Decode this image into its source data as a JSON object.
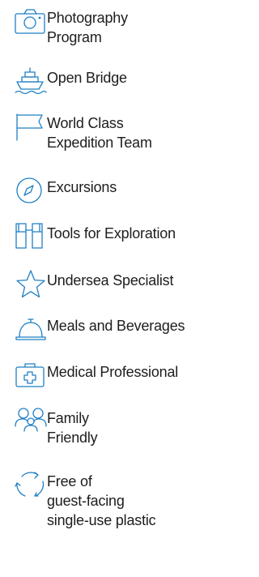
{
  "features": [
    {
      "label": "Photography\nProgram",
      "icon": "camera-icon"
    },
    {
      "label": "Open Bridge",
      "icon": "ship-icon"
    },
    {
      "label": "World Class\nExpedition Team",
      "icon": "flag-icon"
    },
    {
      "label": "Excursions",
      "icon": "compass-icon"
    },
    {
      "label": "Tools for Exploration",
      "icon": "binoculars-icon"
    },
    {
      "label": "Undersea Specialist",
      "icon": "star-icon"
    },
    {
      "label": "Meals and Beverages",
      "icon": "cloche-icon"
    },
    {
      "label": "Medical Professional",
      "icon": "medical-kit-icon"
    },
    {
      "label": "Family\nFriendly",
      "icon": "family-icon"
    },
    {
      "label": "Free of\nguest-facing\nsingle-use plastic",
      "icon": "recycle-icon"
    }
  ],
  "colors": {
    "icon_stroke": "#1f7fc4",
    "text": "#1d1d1f"
  }
}
